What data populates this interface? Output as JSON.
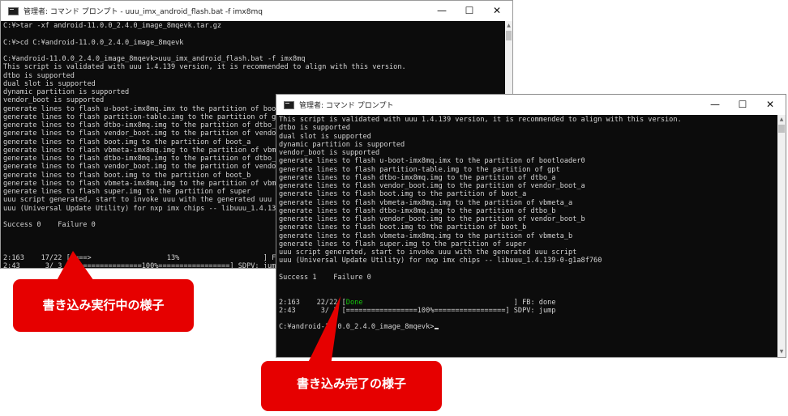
{
  "window1": {
    "title": "管理者: コマンド プロンプト - uuu_imx_android_flash.bat  -f imx8mq",
    "controls": [
      "—",
      "☐",
      "✕"
    ],
    "lines": [
      "C:¥>tar -xf android-11.0.0_2.4.0_image_8mqevk.tar.gz",
      "",
      "C:¥>cd C:¥android-11.0.0_2.4.0_image_8mqevk",
      "",
      "C:¥android-11.0.0_2.4.0_image_8mqevk>uuu_imx_android_flash.bat -f imx8mq",
      "This script is validated with uuu 1.4.139 version, it is recommended to align with this version.",
      "dtbo is supported",
      "dual slot is supported",
      "dynamic partition is supported",
      "vendor_boot is supported",
      "generate lines to flash u-boot-imx8mq.imx to the partition of bootloader0",
      "generate lines to flash partition-table.img to the partition of gpt",
      "generate lines to flash dtbo-imx8mq.img to the partition of dtbo_a",
      "generate lines to flash vendor_boot.img to the partition of vendor_boot_a",
      "generate lines to flash boot.img to the partition of boot_a",
      "generate lines to flash vbmeta-imx8mq.img to the partition of vbmeta_a",
      "generate lines to flash dtbo-imx8mq.img to the partition of dtbo_b",
      "generate lines to flash vendor_boot.img to the partition of vendor_boot_b",
      "generate lines to flash boot.img to the partition of boot_b",
      "generate lines to flash vbmeta-imx8mq.img to the partition of vbmeta_b",
      "generate lines to flash super.img to the partition of super",
      "uuu script generated, start to invoke uuu with the generated uuu script",
      "uuu (Universal Update Utility) for nxp imx chips -- libuuu_1.4.139-0-g1a8f760",
      "",
      "Success 0    Failure 0",
      "",
      "",
      "",
      "2:163    17/22 [====>                  13%                    ] FB[-t 600000]: flash super",
      "2:43      3/ 3 [=================100%=================] SDPV: jump"
    ]
  },
  "window2": {
    "title": "管理者: コマンド プロンプト",
    "controls": [
      "—",
      "☐",
      "✕"
    ],
    "lines_before": [
      "This script is validated with uuu 1.4.139 version, it is recommended to align with this version.",
      "dtbo is supported",
      "dual slot is supported",
      "dynamic partition is supported",
      "vendor_boot is supported",
      "generate lines to flash u-boot-imx8mq.imx to the partition of bootloader0",
      "generate lines to flash partition-table.img to the partition of gpt",
      "generate lines to flash dtbo-imx8mq.img to the partition of dtbo_a",
      "generate lines to flash vendor_boot.img to the partition of vendor_boot_a",
      "generate lines to flash boot.img to the partition of boot_a",
      "generate lines to flash vbmeta-imx8mq.img to the partition of vbmeta_a",
      "generate lines to flash dtbo-imx8mq.img to the partition of dtbo_b",
      "generate lines to flash vendor_boot.img to the partition of vendor_boot_b",
      "generate lines to flash boot.img to the partition of boot_b",
      "generate lines to flash vbmeta-imx8mq.img to the partition of vbmeta_b",
      "generate lines to flash super.img to the partition of super",
      "uuu script generated, start to invoke uuu with the generated uuu script",
      "uuu (Universal Update Utility) for nxp imx chips -- libuuu_1.4.139-0-g1a8f760",
      "",
      "Success 1    Failure 0",
      "",
      ""
    ],
    "progress_line1": {
      "prefix": "2:163    22/22 [",
      "status": "Done",
      "suffix": "                                    ] FB: done"
    },
    "progress_line2": "2:43      3/ 3 [=================100%=================] SDPV: jump",
    "prompt": "C:¥android-11.0.0_2.4.0_image_8mqevk>"
  },
  "callouts": {
    "in_progress": "書き込み実行中の様子",
    "complete": "書き込み完了の様子"
  },
  "colors": {
    "callout": "#e60000",
    "console_bg": "#0c0c0c",
    "console_text": "#d4d4d4",
    "done_green": "#16c60c"
  },
  "icons": [
    "cmd-icon",
    "minimize-icon",
    "maximize-icon",
    "close-icon"
  ]
}
